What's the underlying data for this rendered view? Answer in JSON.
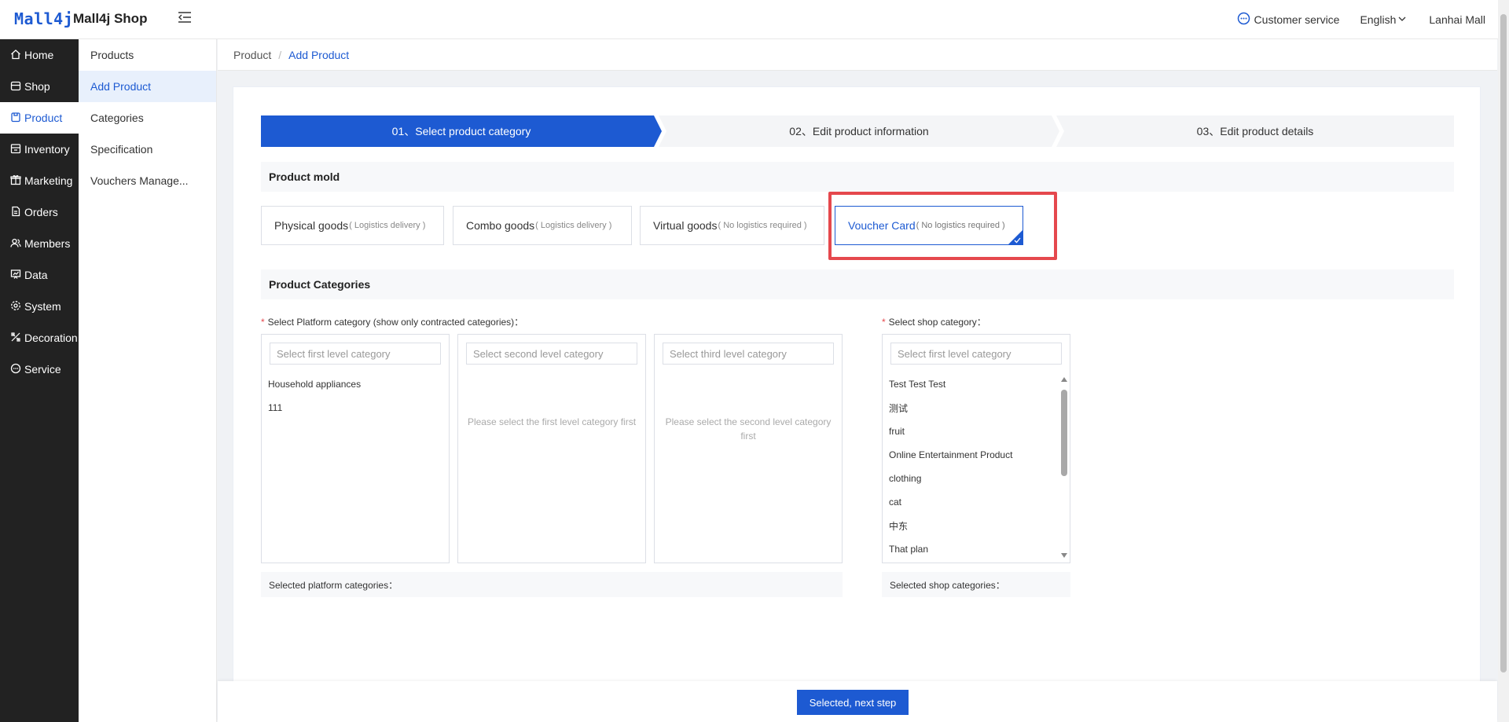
{
  "header": {
    "logo_text": "Mall4j",
    "brand": "Mall4j Shop",
    "customer_service": "Customer service",
    "language": "English",
    "user": "Lanhai Mall"
  },
  "sidebar": {
    "items": [
      {
        "label": "Home",
        "icon": "home-icon"
      },
      {
        "label": "Shop",
        "icon": "shop-icon"
      },
      {
        "label": "Product",
        "icon": "product-icon",
        "active": true
      },
      {
        "label": "Inventory",
        "icon": "inventory-icon"
      },
      {
        "label": "Marketing",
        "icon": "marketing-icon"
      },
      {
        "label": "Orders",
        "icon": "orders-icon"
      },
      {
        "label": "Members",
        "icon": "members-icon"
      },
      {
        "label": "Data",
        "icon": "data-icon"
      },
      {
        "label": "System",
        "icon": "system-icon"
      },
      {
        "label": "Decoration",
        "icon": "decoration-icon"
      },
      {
        "label": "Service",
        "icon": "service-icon"
      }
    ]
  },
  "submenu": {
    "items": [
      {
        "label": "Products"
      },
      {
        "label": "Add Product",
        "active": true
      },
      {
        "label": "Categories"
      },
      {
        "label": "Specification"
      },
      {
        "label": "Vouchers Manage..."
      }
    ]
  },
  "breadcrumb": {
    "parent": "Product",
    "separator": "/",
    "current": "Add Product"
  },
  "steps": [
    {
      "label": "01、Select product category",
      "active": true
    },
    {
      "label": "02、Edit product information",
      "active": false
    },
    {
      "label": "03、Edit product details",
      "active": false
    }
  ],
  "product_mold": {
    "title": "Product mold",
    "options": [
      {
        "name": "Physical goods",
        "note": "( Logistics delivery )",
        "selected": false
      },
      {
        "name": "Combo goods",
        "note": "( Logistics delivery )",
        "selected": false
      },
      {
        "name": "Virtual goods",
        "note": "( No logistics required )",
        "selected": false
      },
      {
        "name": "Voucher Card",
        "note": "( No logistics required )",
        "selected": true
      }
    ]
  },
  "categories": {
    "title": "Product Categories",
    "platform_label": "Select Platform category (show only contracted categories)：",
    "shop_label": "Select shop category：",
    "platform_first": {
      "placeholder": "Select first level category",
      "items": [
        "Household appliances",
        "111"
      ]
    },
    "platform_second": {
      "placeholder": "Select second level category",
      "empty": "Please select the first level category first"
    },
    "platform_third": {
      "placeholder": "Select third level category",
      "empty": "Please select the second level category first"
    },
    "shop_first": {
      "placeholder": "Select first level category",
      "items": [
        "Test Test Test",
        "测试",
        "fruit",
        "Online Entertainment Product",
        "clothing",
        "cat",
        "中东",
        "That plan"
      ]
    },
    "selected_platform": "Selected platform categories：",
    "selected_shop": "Selected shop categories："
  },
  "footer": {
    "next_button": "Selected, next step"
  },
  "colors": {
    "primary": "#1d5ad2",
    "sidebar_bg": "#222222",
    "highlight": "#e5484d"
  }
}
